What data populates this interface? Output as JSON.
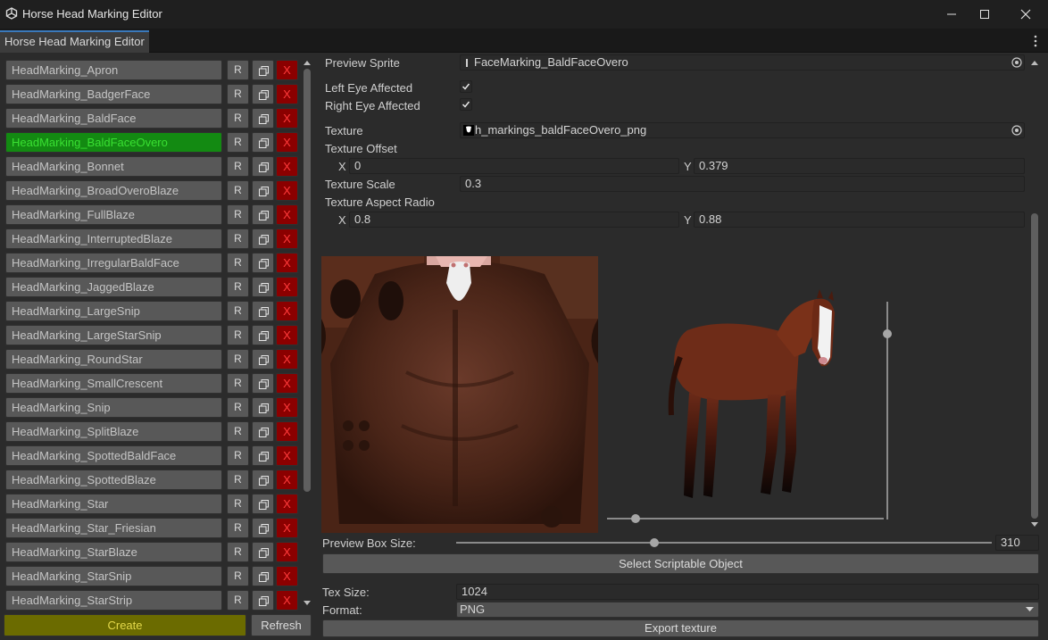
{
  "window": {
    "title": "Horse Head Marking Editor",
    "tab_label": "Horse Head Marking Editor"
  },
  "list": {
    "items": [
      {
        "label": "HeadMarking_Apron",
        "selected": false
      },
      {
        "label": "HeadMarking_BadgerFace",
        "selected": false
      },
      {
        "label": "HeadMarking_BaldFace",
        "selected": false
      },
      {
        "label": "HeadMarking_BaldFaceOvero",
        "selected": true
      },
      {
        "label": "HeadMarking_Bonnet",
        "selected": false
      },
      {
        "label": "HeadMarking_BroadOveroBlaze",
        "selected": false
      },
      {
        "label": "HeadMarking_FullBlaze",
        "selected": false
      },
      {
        "label": "HeadMarking_InterruptedBlaze",
        "selected": false
      },
      {
        "label": "HeadMarking_IrregularBaldFace",
        "selected": false
      },
      {
        "label": "HeadMarking_JaggedBlaze",
        "selected": false
      },
      {
        "label": "HeadMarking_LargeSnip",
        "selected": false
      },
      {
        "label": "HeadMarking_LargeStarSnip",
        "selected": false
      },
      {
        "label": "HeadMarking_RoundStar",
        "selected": false
      },
      {
        "label": "HeadMarking_SmallCrescent",
        "selected": false
      },
      {
        "label": "HeadMarking_Snip",
        "selected": false
      },
      {
        "label": "HeadMarking_SplitBlaze",
        "selected": false
      },
      {
        "label": "HeadMarking_SpottedBaldFace",
        "selected": false
      },
      {
        "label": "HeadMarking_SpottedBlaze",
        "selected": false
      },
      {
        "label": "HeadMarking_Star",
        "selected": false
      },
      {
        "label": "HeadMarking_Star_Friesian",
        "selected": false
      },
      {
        "label": "HeadMarking_StarBlaze",
        "selected": false
      },
      {
        "label": "HeadMarking_StarSnip",
        "selected": false
      },
      {
        "label": "HeadMarking_StarStrip",
        "selected": false
      }
    ],
    "rename_label": "R",
    "delete_label": "X",
    "create_label": "Create",
    "refresh_label": "Refresh"
  },
  "inspector": {
    "preview_sprite_label": "Preview Sprite",
    "preview_sprite_value": "FaceMarking_BaldFaceOvero",
    "left_eye_label": "Left Eye Affected",
    "left_eye_checked": true,
    "right_eye_label": "Right Eye Affected",
    "right_eye_checked": true,
    "texture_label": "Texture",
    "texture_value": "h_markings_baldFaceOvero_png",
    "texture_offset_label": "Texture Offset",
    "offset_x_label": "X",
    "offset_x": "0",
    "offset_y_label": "Y",
    "offset_y": "0.379",
    "texture_scale_label": "Texture Scale",
    "texture_scale": "0.3",
    "aspect_label": "Texture Aspect Radio",
    "aspect_x_label": "X",
    "aspect_x": "0.8",
    "aspect_y_label": "Y",
    "aspect_y": "0.88",
    "preview_box_label": "Preview Box Size:",
    "preview_box_value": "310",
    "preview_box_fraction": 0.37,
    "select_so_label": "Select Scriptable Object",
    "tex_size_label": "Tex Size:",
    "tex_size_value": "1024",
    "format_label": "Format:",
    "format_value": "PNG",
    "export_label": "Export texture"
  },
  "colors": {
    "selected_bg": "#138a12",
    "selected_text": "#39e032",
    "delete_bg": "#8b0000",
    "create_bg": "#6b6b00"
  }
}
